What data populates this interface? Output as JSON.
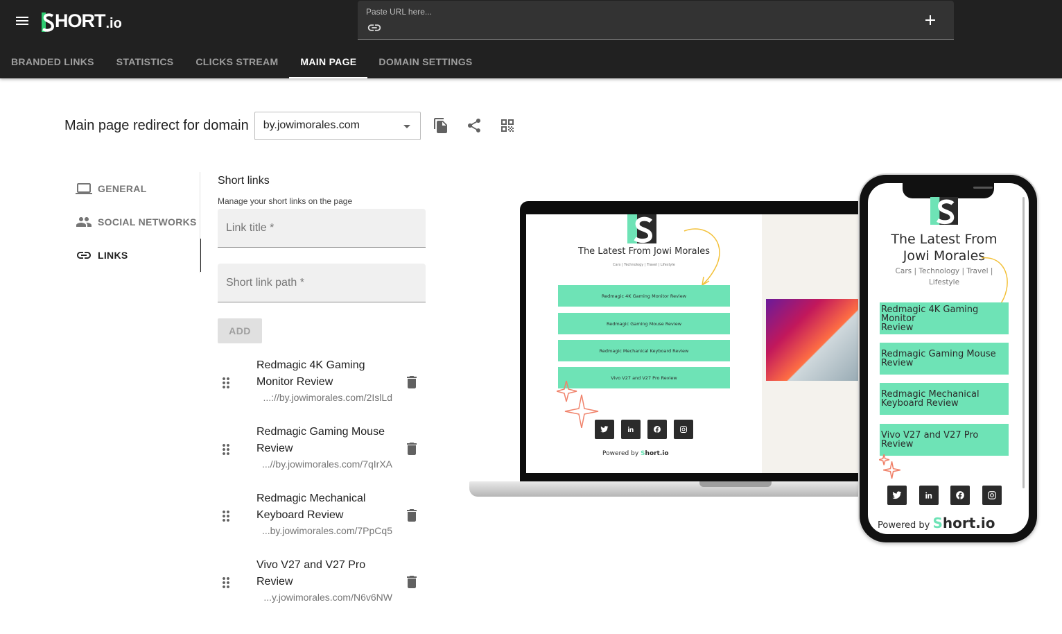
{
  "topbar": {
    "logo_text": "HORT",
    "logo_suffix": ".io",
    "url_placeholder": "Paste URL here...",
    "tabs": [
      {
        "label": "BRANDED LINKS"
      },
      {
        "label": "STATISTICS"
      },
      {
        "label": "CLICKS STREAM"
      },
      {
        "label": "MAIN PAGE",
        "active": true
      },
      {
        "label": "DOMAIN SETTINGS"
      }
    ]
  },
  "main": {
    "heading": "Main page redirect for domain",
    "domain": "by.jowimorales.com"
  },
  "sidenav": {
    "items": [
      {
        "label": "GENERAL",
        "icon": "laptop-icon"
      },
      {
        "label": "SOCIAL NETWORKS",
        "icon": "people-icon"
      },
      {
        "label": "LINKS",
        "icon": "link-icon",
        "active": true
      }
    ]
  },
  "links_panel": {
    "title": "Short links",
    "subtitle": "Manage your short links on the page",
    "link_title_placeholder": "Link title *",
    "short_path_placeholder": "Short link path *",
    "add_label": "ADD",
    "items": [
      {
        "title": "Redmagic 4K Gaming Monitor Review",
        "url": "...://by.jowimorales.com/2IslLd"
      },
      {
        "title": "Redmagic Gaming Mouse Review",
        "url": "...//by.jowimorales.com/7qIrXA"
      },
      {
        "title": "Redmagic Mechanical Keyboard Review",
        "url": "...by.jowimorales.com/7PpCq5"
      },
      {
        "title": "Vivo V27 and V27 Pro Review",
        "url": "...y.jowimorales.com/N6v6NW"
      }
    ]
  },
  "preview": {
    "page_title": "The Latest From Jowi Morales",
    "phone_title_line1": "The Latest From",
    "phone_title_line2": "Jowi Morales",
    "tagline": "Cars | Technology | Travel | Lifestyle",
    "phone_tagline_line1": "Cars | Technology | Travel |",
    "phone_tagline_line2": "Lifestyle",
    "buttons": [
      "Redmagic 4K Gaming Monitor Review",
      "Redmagic Gaming Mouse Review",
      "Redmagic Mechanical Keyboard Review",
      "Vivo V27 and V27 Pro Review"
    ],
    "phone_buttons": [
      {
        "line1": "Redmagic 4K Gaming Monitor",
        "line2": "Review"
      },
      {
        "line1": "Redmagic Gaming Mouse",
        "line2": "Review"
      },
      {
        "line1": "Redmagic Mechanical",
        "line2": "Keyboard Review"
      },
      {
        "line1": "Vivo V27 and V27 Pro Review",
        "line2": ""
      }
    ],
    "powered_by": "Powered by",
    "brand": "hort.io",
    "brand_color": "#6ee3b6",
    "accent_color": "#2ecc71"
  }
}
